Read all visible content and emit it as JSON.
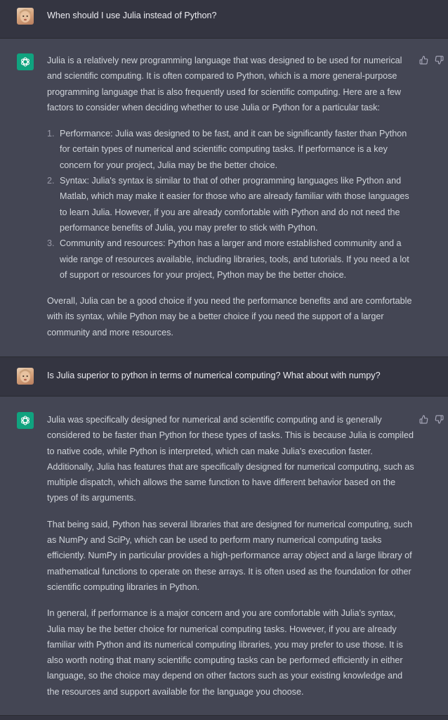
{
  "conversation": [
    {
      "role": "user",
      "text": "When should I use Julia instead of Python?"
    },
    {
      "role": "assistant",
      "intro": "Julia is a relatively new programming language that was designed to be used for numerical and scientific computing. It is often compared to Python, which is a more general-purpose programming language that is also frequently used for scientific computing. Here are a few factors to consider when deciding whether to use Julia or Python for a particular task:",
      "list": [
        {
          "num": "1.",
          "text": "Performance: Julia was designed to be fast, and it can be significantly faster than Python for certain types of numerical and scientific computing tasks. If performance is a key concern for your project, Julia may be the better choice."
        },
        {
          "num": "2.",
          "text": "Syntax: Julia's syntax is similar to that of other programming languages like Python and Matlab, which may make it easier for those who are already familiar with those languages to learn Julia. However, if you are already comfortable with Python and do not need the performance benefits of Julia, you may prefer to stick with Python."
        },
        {
          "num": "3.",
          "text": "Community and resources: Python has a larger and more established community and a wide range of resources available, including libraries, tools, and tutorials. If you need a lot of support or resources for your project, Python may be the better choice."
        }
      ],
      "outro": "Overall, Julia can be a good choice if you need the performance benefits and are comfortable with its syntax, while Python may be a better choice if you need the support of a larger community and more resources."
    },
    {
      "role": "user",
      "text": "Is Julia superior to python in terms of numerical computing? What about with numpy?"
    },
    {
      "role": "assistant",
      "paragraphs": [
        "Julia was specifically designed for numerical and scientific computing and is generally considered to be faster than Python for these types of tasks. This is because Julia is compiled to native code, while Python is interpreted, which can make Julia's execution faster. Additionally, Julia has features that are specifically designed for numerical computing, such as multiple dispatch, which allows the same function to have different behavior based on the types of its arguments.",
        "That being said, Python has several libraries that are designed for numerical computing, such as NumPy and SciPy, which can be used to perform many numerical computing tasks efficiently. NumPy in particular provides a high-performance array object and a large library of mathematical functions to operate on these arrays. It is often used as the foundation for other scientific computing libraries in Python.",
        "In general, if performance is a major concern and you are comfortable with Julia's syntax, Julia may be the better choice for numerical computing tasks. However, if you are already familiar with Python and its numerical computing libraries, you may prefer to use those. It is also worth noting that many scientific computing tasks can be performed efficiently in either language, so the choice may depend on other factors such as your existing knowledge and the resources and support available for the language you choose."
      ]
    }
  ],
  "icons": {
    "user_avatar": "user-avatar-photo",
    "assistant_avatar": "openai-logo-icon",
    "like": "thumbs-up-icon",
    "dislike": "thumbs-down-icon"
  },
  "colors": {
    "background_user": "#343541",
    "background_assistant": "#444654",
    "assistant_logo": "#10a37f",
    "text": "#d1d5db"
  }
}
